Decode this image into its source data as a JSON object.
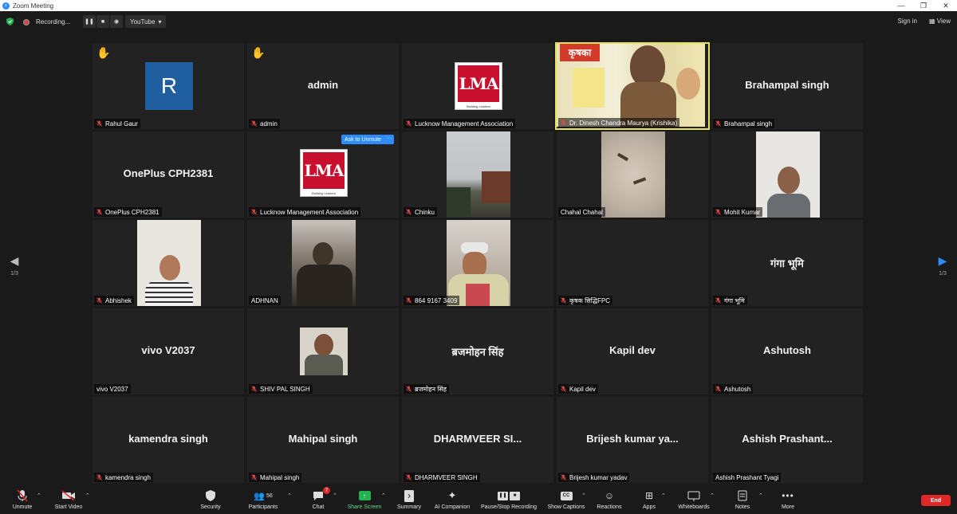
{
  "window": {
    "title": "Zoom Meeting"
  },
  "topbar": {
    "recording_label": "Recording...",
    "pause_icon": "pause-icon",
    "stop_icon": "stop-icon",
    "stream_label": "YouTube",
    "signin_label": "Sign in",
    "view_label": "View"
  },
  "colors": {
    "accent": "#2d8cff",
    "active_speaker": "#e6e255",
    "end": "#e02828",
    "share": "#24b14f",
    "tile": "#222222"
  },
  "pagination": {
    "left": "1/3",
    "right": "1/3"
  },
  "tiles": [
    {
      "display": "R",
      "label": "Rahul Gaur",
      "hand": true,
      "kind": "avatar"
    },
    {
      "display": "admin",
      "label": "admin",
      "hand": true,
      "kind": "name"
    },
    {
      "display": "LMA",
      "label": "Lucknow Management Association",
      "kind": "logo"
    },
    {
      "display": "",
      "label": "Dr. Dinesh Chandra Maurya (Krishika)",
      "kind": "video",
      "active": true
    },
    {
      "display": "Brahampal singh",
      "label": "Brahampal singh",
      "kind": "name"
    },
    {
      "display": "OnePlus CPH2381",
      "label": "OnePlus CPH2381",
      "kind": "name"
    },
    {
      "display": "LMA",
      "label": "Lucknow Management Association",
      "kind": "logo",
      "ask_unmute": "Ask to Unmute",
      "more": "···"
    },
    {
      "display": "",
      "label": "Chinku",
      "kind": "video"
    },
    {
      "display": "",
      "label": "Chahal Chahal",
      "kind": "video",
      "muted": false
    },
    {
      "display": "",
      "label": "Mohit Kumar",
      "kind": "video"
    },
    {
      "display": "",
      "label": "Abhishek",
      "kind": "video"
    },
    {
      "display": "",
      "label": "ADHNAN",
      "kind": "video",
      "muted": false
    },
    {
      "display": "",
      "label": "864 9167 3409",
      "kind": "video"
    },
    {
      "display": "",
      "label": "कृषक सिद्धिFPC",
      "kind": "blank"
    },
    {
      "display": "गंगा भूमि",
      "label": "गंगा भूमि",
      "kind": "name"
    },
    {
      "display": "vivo V2037",
      "label": "vivo V2037",
      "kind": "name",
      "muted": false
    },
    {
      "display": "",
      "label": "SHIV PAL SINGH",
      "kind": "photo"
    },
    {
      "display": "ब्रजमोहन सिंह",
      "label": "ब्रजमोहन सिंह",
      "kind": "name"
    },
    {
      "display": "Kapil dev",
      "label": "Kapil dev",
      "kind": "name"
    },
    {
      "display": "Ashutosh",
      "label": "Ashutosh",
      "kind": "name"
    },
    {
      "display": "kamendra singh",
      "label": "kamendra singh",
      "kind": "name"
    },
    {
      "display": "Mahipal singh",
      "label": "Mahipal singh",
      "kind": "name"
    },
    {
      "display": "DHARMVEER  SI...",
      "label": "DHARMVEER SINGH",
      "kind": "name"
    },
    {
      "display": "Brijesh  kumar  ya...",
      "label": "Brijesh kumar yadav",
      "kind": "name"
    },
    {
      "display": "Ashish  Prashant...",
      "label": "Ashish Prashant Tyagi",
      "kind": "name",
      "muted": false
    }
  ],
  "lma_sub": "Building Leaders",
  "toolbar": {
    "unmute": "Unmute",
    "start_video": "Start Video",
    "security": "Security",
    "participants": "Participants",
    "participants_count": "56",
    "chat": "Chat",
    "chat_badge": "7",
    "share_screen": "Share Screen",
    "summary": "Summary",
    "ai_companion": "AI Companion",
    "pause_stop_recording": "Pause/Stop Recording",
    "show_captions": "Show Captions",
    "reactions": "Reactions",
    "apps": "Apps",
    "whiteboards": "Whiteboards",
    "notes": "Notes",
    "more": "More",
    "end": "End"
  }
}
